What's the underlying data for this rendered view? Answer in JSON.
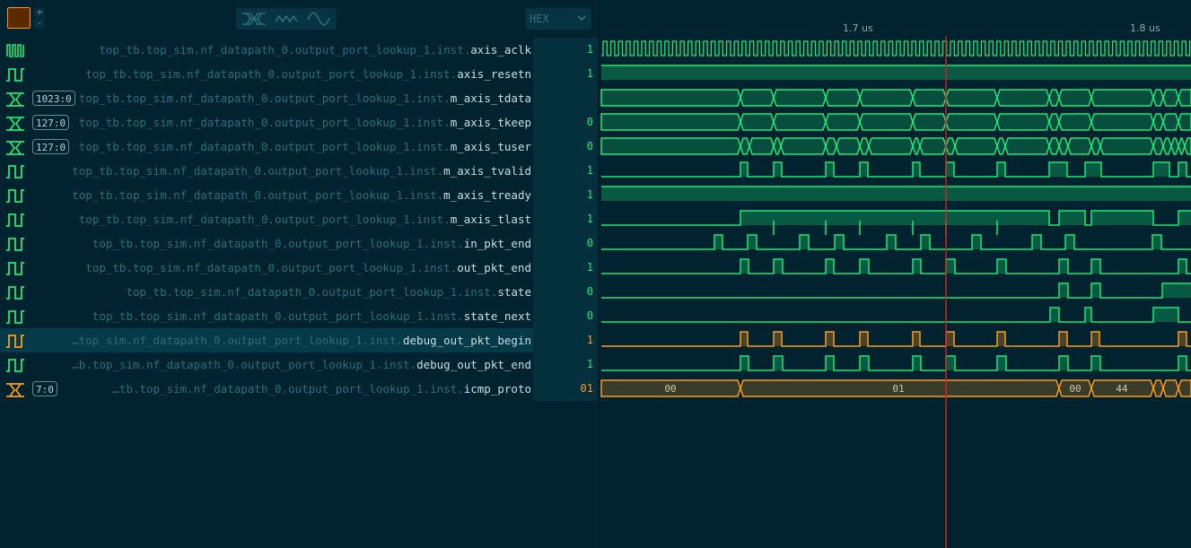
{
  "toolbar": {
    "color_icon": "color-swatch",
    "plus_label": "+",
    "minus_label": "-",
    "shape_buttons": [
      "bus-shape-icon",
      "step-shape-icon",
      "sine-shape-icon"
    ],
    "radix": {
      "selected": "HEX",
      "chevron_icon": "chevron-down-icon"
    }
  },
  "ruler": {
    "ticks": [
      {
        "label": "1.7 us"
      },
      {
        "label": "1.8 us"
      }
    ]
  },
  "cursor": {
    "color": "#d21f1f"
  },
  "colors": {
    "green": "#1ee876",
    "orange": "#ff9a1a",
    "background": "#012330"
  },
  "signals": [
    {
      "prefix": "top_tb.top_sim.nf_datapath_0.output_port_lookup_1.inst.",
      "leaf": "axis_aclk",
      "value": "1",
      "width": "",
      "icon": "clock-icon",
      "color": "green",
      "selected": false
    },
    {
      "prefix": "top_tb.top_sim.nf_datapath_0.output_port_lookup_1.inst.",
      "leaf": "axis_resetn",
      "value": "1",
      "width": "",
      "icon": "bit-signal-icon",
      "color": "green",
      "selected": false
    },
    {
      "prefix": "top_tb.top_sim.nf_datapath_0.output_port_lookup_1.inst.",
      "leaf": "m_axis_tdata",
      "value": "",
      "width": "1023:0",
      "icon": "bus-signal-icon",
      "color": "green",
      "selected": false
    },
    {
      "prefix": "top_tb.top_sim.nf_datapath_0.output_port_lookup_1.inst.",
      "leaf": "m_axis_tkeep",
      "value": "0",
      "width": "127:0",
      "icon": "bus-signal-icon",
      "color": "green",
      "selected": false
    },
    {
      "prefix": "top_tb.top_sim.nf_datapath_0.output_port_lookup_1.inst.",
      "leaf": "m_axis_tuser",
      "value": "0",
      "width": "127:0",
      "icon": "bus-signal-icon",
      "color": "green",
      "selected": false
    },
    {
      "prefix": "top_tb.top_sim.nf_datapath_0.output_port_lookup_1.inst.",
      "leaf": "m_axis_tvalid",
      "value": "1",
      "width": "",
      "icon": "bit-signal-icon",
      "color": "green",
      "selected": false
    },
    {
      "prefix": "top_tb.top_sim.nf_datapath_0.output_port_lookup_1.inst.",
      "leaf": "m_axis_tready",
      "value": "1",
      "width": "",
      "icon": "bit-signal-icon",
      "color": "green",
      "selected": false
    },
    {
      "prefix": "top_tb.top_sim.nf_datapath_0.output_port_lookup_1.inst.",
      "leaf": "m_axis_tlast",
      "value": "1",
      "width": "",
      "icon": "bit-signal-icon",
      "color": "green",
      "selected": false
    },
    {
      "prefix": "top_tb.top_sim.nf_datapath_0.output_port_lookup_1.inst.",
      "leaf": "in_pkt_end",
      "value": "0",
      "width": "",
      "icon": "bit-signal-icon",
      "color": "green",
      "selected": false
    },
    {
      "prefix": "top_tb.top_sim.nf_datapath_0.output_port_lookup_1.inst.",
      "leaf": "out_pkt_end",
      "value": "1",
      "width": "",
      "icon": "bit-signal-icon",
      "color": "green",
      "selected": false
    },
    {
      "prefix": "top_tb.top_sim.nf_datapath_0.output_port_lookup_1.inst.",
      "leaf": "state",
      "value": "0",
      "width": "",
      "icon": "bit-signal-icon",
      "color": "green",
      "selected": false
    },
    {
      "prefix": "top_tb.top_sim.nf_datapath_0.output_port_lookup_1.inst.",
      "leaf": "state_next",
      "value": "0",
      "width": "",
      "icon": "bit-signal-icon",
      "color": "green",
      "selected": false
    },
    {
      "prefix": "…top_sim.nf_datapath_0.output_port_lookup_1.inst.",
      "leaf": "debug_out_pkt_begin",
      "value": "1",
      "width": "",
      "icon": "bit-signal-icon",
      "color": "orange",
      "selected": true
    },
    {
      "prefix": "…b.top_sim.nf_datapath_0.output_port_lookup_1.inst.",
      "leaf": "debug_out_pkt_end",
      "value": "1",
      "width": "",
      "icon": "bit-signal-icon",
      "color": "green",
      "selected": false
    },
    {
      "prefix": "…tb.top_sim.nf_datapath_0.output_port_lookup_1.inst.",
      "leaf": "icmp_proto",
      "value": "01",
      "width": "7:0",
      "icon": "bus-signal-icon",
      "color": "orange",
      "selected": false
    }
  ],
  "bus_labels": {
    "icmp_proto": [
      "00",
      "01",
      "00",
      "44"
    ]
  }
}
